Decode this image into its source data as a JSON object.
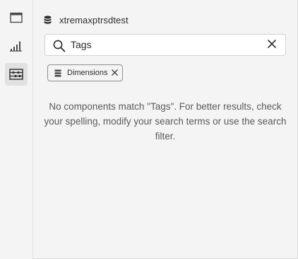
{
  "rail": {
    "items": [
      {
        "icon": "panel-icon",
        "active": false
      },
      {
        "icon": "bar-chart-icon",
        "active": false
      },
      {
        "icon": "components-icon",
        "active": true
      }
    ]
  },
  "source": {
    "label": "xtremaxptrsdtest",
    "icon": "database-icon"
  },
  "search": {
    "value": "Tags",
    "icon": "search-icon",
    "clear_icon": "close-icon"
  },
  "filter_chip": {
    "label": "Dimensions",
    "icon": "dimension-stack-icon",
    "remove_icon": "close-icon"
  },
  "empty_message": "No components match \"Tags\". For better results, check your spelling, modify your search terms or use the search filter."
}
